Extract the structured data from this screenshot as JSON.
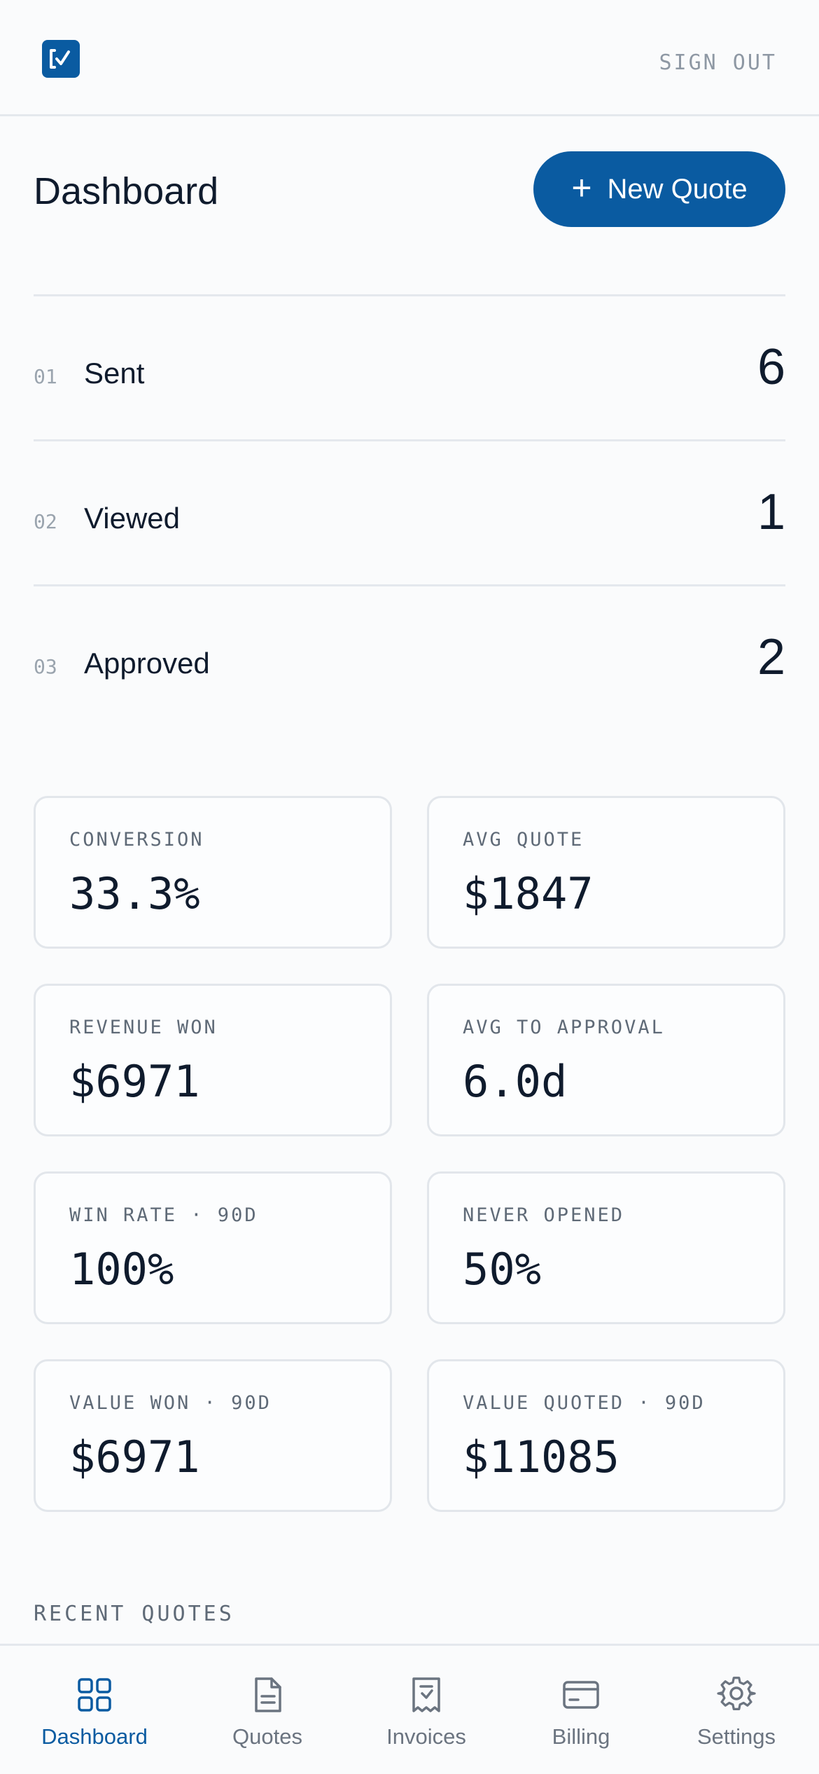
{
  "header": {
    "logo_icon": "check-square-icon",
    "sign_out_label": "SIGN OUT"
  },
  "page": {
    "title": "Dashboard",
    "new_quote_label": "New Quote"
  },
  "statuses": [
    {
      "index": "01",
      "label": "Sent",
      "count": "6"
    },
    {
      "index": "02",
      "label": "Viewed",
      "count": "1"
    },
    {
      "index": "03",
      "label": "Approved",
      "count": "2"
    }
  ],
  "metrics": [
    {
      "label": "CONVERSION",
      "value": "33.3%"
    },
    {
      "label": "AVG QUOTE",
      "value": "$1847"
    },
    {
      "label": "REVENUE WON",
      "value": "$6971"
    },
    {
      "label": "AVG TO APPROVAL",
      "value": "6.0d"
    },
    {
      "label": "WIN RATE · 90D",
      "value": "100%"
    },
    {
      "label": "NEVER OPENED",
      "value": "50%"
    },
    {
      "label": "VALUE WON · 90D",
      "value": "$6971"
    },
    {
      "label": "VALUE QUOTED · 90D",
      "value": "$11085"
    }
  ],
  "recent_quotes_heading": "RECENT QUOTES",
  "nav": [
    {
      "label": "Dashboard",
      "icon": "grid-icon",
      "active": true
    },
    {
      "label": "Quotes",
      "icon": "document-icon",
      "active": false
    },
    {
      "label": "Invoices",
      "icon": "receipt-icon",
      "active": false
    },
    {
      "label": "Billing",
      "icon": "credit-card-icon",
      "active": false
    },
    {
      "label": "Settings",
      "icon": "gear-icon",
      "active": false
    }
  ],
  "colors": {
    "accent": "#0a5ba1",
    "text": "#0f1b2d",
    "muted": "#6b7480",
    "background": "#fafbfc"
  }
}
